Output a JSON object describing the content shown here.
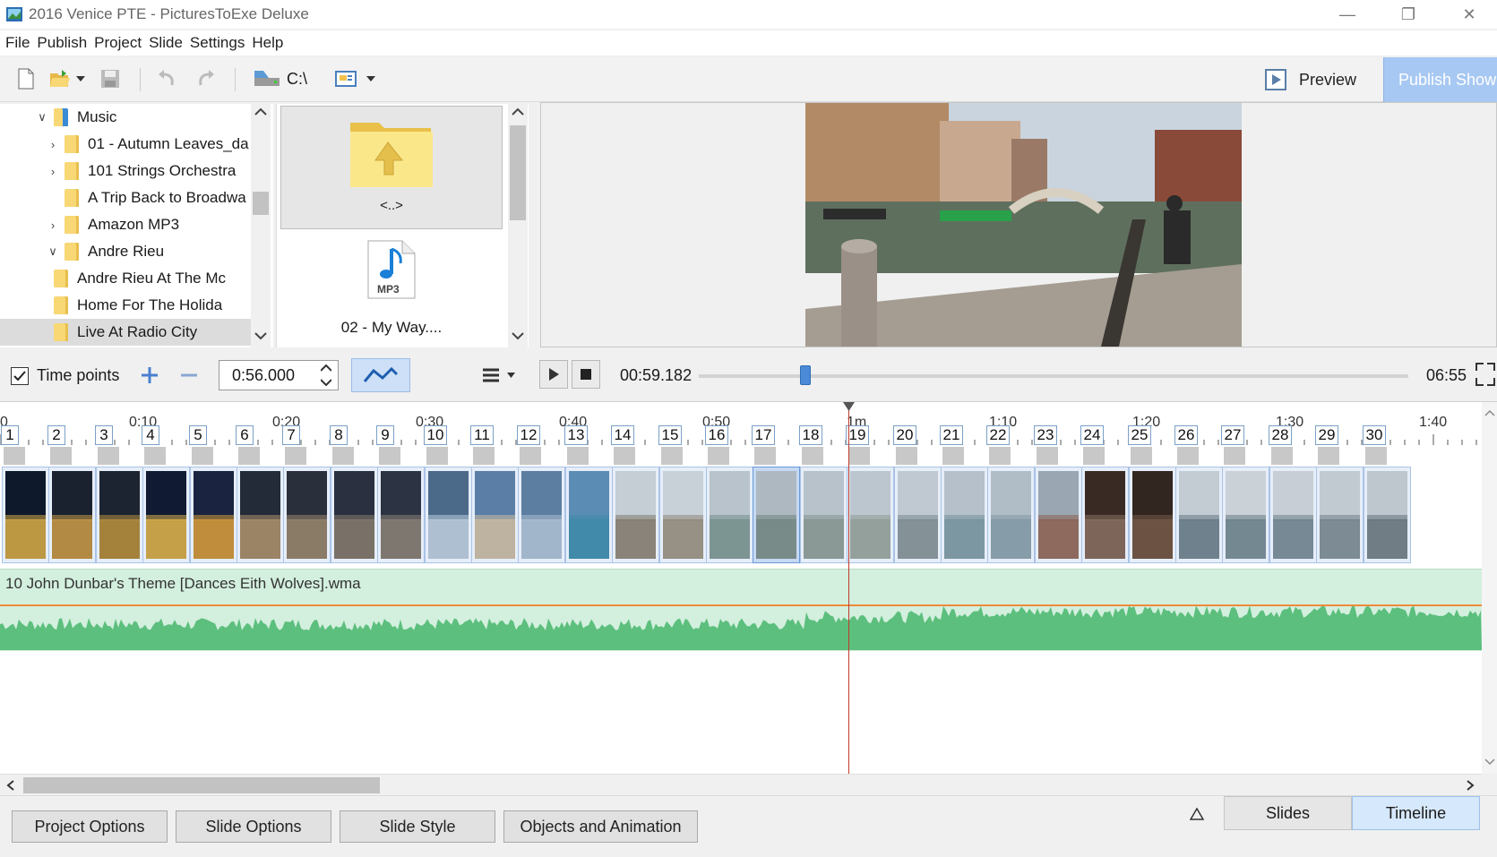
{
  "window": {
    "title": "2016 Venice PTE - PicturesToExe Deluxe",
    "icon": "app-icon",
    "minimize_glyph": "—",
    "restore_glyph": "❐",
    "close_glyph": "✕"
  },
  "menu": [
    "File",
    "Publish",
    "Project",
    "Slide",
    "Settings",
    "Help"
  ],
  "toolbar": {
    "drive_label": "C:\\",
    "preview_label": "Preview",
    "publish_label": "Publish Show"
  },
  "folder_tree": {
    "items": [
      {
        "label": "Music",
        "arrow": "∨",
        "indent": 0,
        "selected": false
      },
      {
        "label": "01 - Autumn Leaves_da",
        "arrow": "›",
        "indent": 1,
        "selected": false
      },
      {
        "label": "101 Strings Orchestra",
        "arrow": "›",
        "indent": 1,
        "selected": false
      },
      {
        "label": "A Trip Back to Broadwa",
        "arrow": "",
        "indent": 1,
        "selected": false
      },
      {
        "label": "Amazon MP3",
        "arrow": "›",
        "indent": 1,
        "selected": false
      },
      {
        "label": "Andre Rieu",
        "arrow": "∨",
        "indent": 1,
        "selected": false
      },
      {
        "label": "Andre Rieu At The Mc",
        "arrow": "",
        "indent": 2,
        "selected": false
      },
      {
        "label": "Home For The Holida",
        "arrow": "",
        "indent": 2,
        "selected": false
      },
      {
        "label": "Live At Radio City",
        "arrow": "",
        "indent": 2,
        "selected": true
      }
    ]
  },
  "file_browser": {
    "up_label": "<..>",
    "file_label": "02 - My Way....",
    "file_badge": "MP3"
  },
  "controls": {
    "time_points_label": "Time points",
    "time_points_checked": true,
    "duration_value": "0:56.000",
    "current_time": "00:59.182",
    "total_time": "06:55",
    "position_fraction": 0.143
  },
  "timeline": {
    "ruler_times": [
      "0",
      "0:10",
      "0:20",
      "0:30",
      "0:40",
      "0:50",
      "1m",
      "1:10",
      "1:20",
      "1:30",
      "1:40"
    ],
    "slide_numbers": [
      "1",
      "2",
      "3",
      "4",
      "5",
      "6",
      "7",
      "8",
      "9",
      "10",
      "11",
      "12",
      "13",
      "14",
      "15",
      "16",
      "17",
      "18",
      "19",
      "20",
      "21",
      "22",
      "23",
      "24",
      "25",
      "26",
      "27",
      "28",
      "29",
      "30"
    ],
    "selected_slide": "17",
    "audio_file": "10 John Dunbar's Theme [Dances Eith Wolves].wma"
  },
  "bottom_bar": {
    "buttons": [
      "Project Options",
      "Slide Options",
      "Slide Style",
      "Objects and Animation"
    ],
    "tabs": [
      "Slides",
      "Timeline"
    ],
    "active_tab": "Timeline"
  },
  "colors": {
    "accent": "#a7c8f2",
    "waveform": "#5cbf7d",
    "playhead": "#c0392b",
    "folder": "#f8d775"
  }
}
